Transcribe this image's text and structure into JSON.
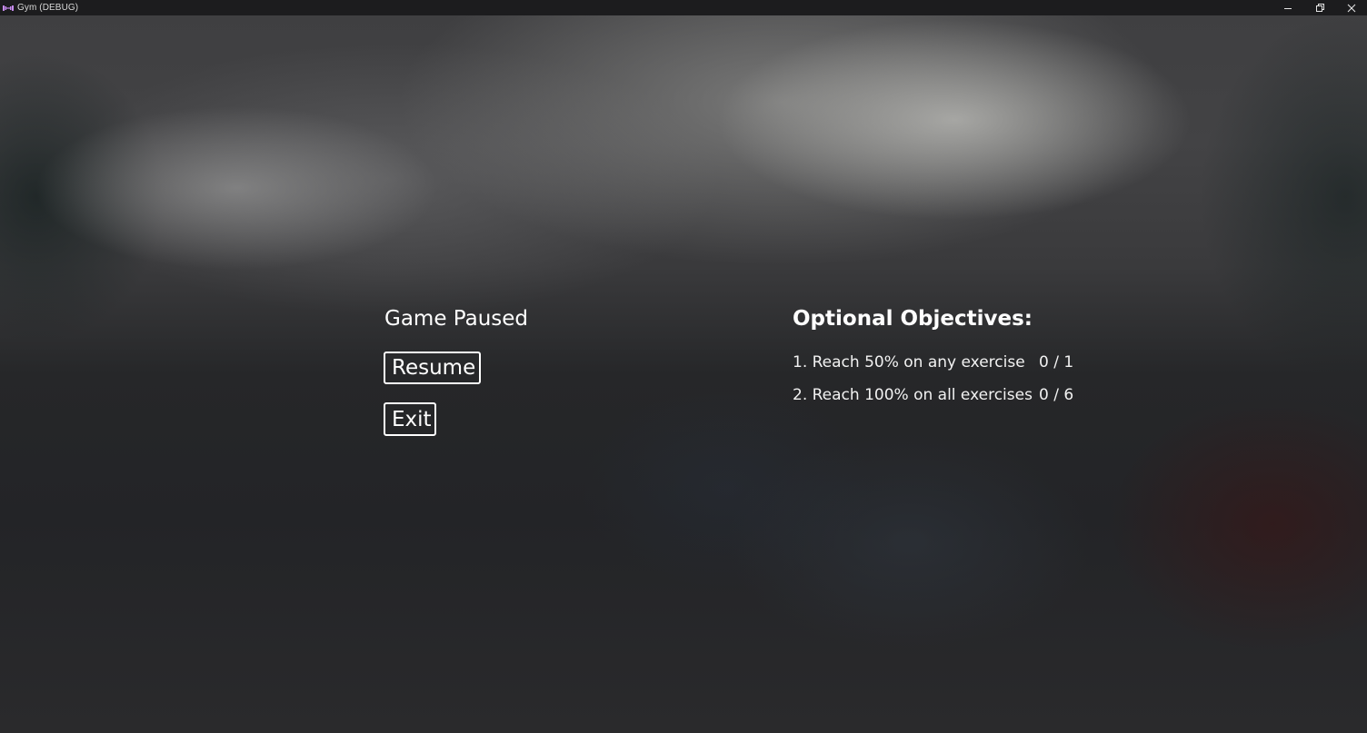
{
  "window": {
    "title": "Gym (DEBUG)",
    "icon": "dumbbell-icon",
    "controls": {
      "minimize": "minimize-icon",
      "restore": "restore-icon",
      "close": "close-icon"
    }
  },
  "pause_menu": {
    "title": "Game Paused",
    "resume_label": "Resume",
    "exit_label": "Exit"
  },
  "objectives": {
    "title": "Optional Objectives:",
    "items": [
      {
        "text": "1. Reach 50% on any exercise",
        "progress": "0 / 1"
      },
      {
        "text": "2. Reach 100% on all exercises",
        "progress": "0 / 6"
      }
    ]
  },
  "colors": {
    "titlebar": "#1c1c1e",
    "text": "#ffffff",
    "icon_accent": "#c88cf0"
  }
}
